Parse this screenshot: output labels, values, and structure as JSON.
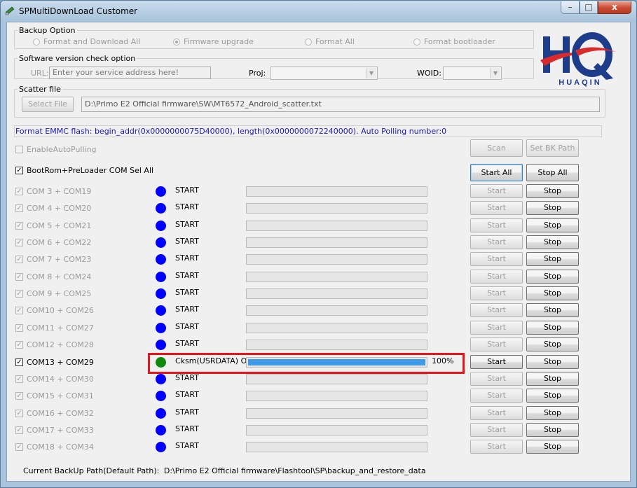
{
  "window": {
    "title": "SPMultiDownLoad Customer",
    "minimize_glyph": "–",
    "maximize_glyph": "□",
    "close_glyph": "x"
  },
  "backup": {
    "legend": "Backup Option",
    "options": [
      {
        "label": "Format and Download All",
        "selected": false
      },
      {
        "label": "Firmware upgrade",
        "selected": true
      },
      {
        "label": "Format All",
        "selected": false
      },
      {
        "label": "Format bootloader",
        "selected": false
      }
    ]
  },
  "version_check": {
    "legend": "Software version check option",
    "url_label": "URL:",
    "url_placeholder": "Enter your service address here!",
    "proj_label": "Proj:",
    "woid_label": "WOID:"
  },
  "scatter": {
    "legend": "Scatter file",
    "select_button": "Select File",
    "path": "D:\\Primo E2 Official firmware\\SW\\MT6572_Android_scatter.txt"
  },
  "info_line": "Format EMMC flash:  begin_addr(0x0000000075D40000), length(0x0000000072240000). Auto Polling number:0",
  "controls": {
    "enable_auto_pulling": "EnableAutoPulling",
    "bootrom_label": "BootRom+PreLoader COM Sel All",
    "scan": "Scan",
    "set_bk_path": "Set BK Path",
    "start_all": "Start All",
    "stop_all": "Stop All"
  },
  "ports": [
    {
      "label": "COM 3 + COM19",
      "status": "START",
      "start": "Start",
      "stop": "Stop",
      "checked": true,
      "enabled": false,
      "progress": 0,
      "percent": "",
      "done": false
    },
    {
      "label": "COM 4 + COM20",
      "status": "START",
      "start": "Start",
      "stop": "Stop",
      "checked": true,
      "enabled": false,
      "progress": 0,
      "percent": "",
      "done": false
    },
    {
      "label": "COM 5 + COM21",
      "status": "START",
      "start": "Start",
      "stop": "Stop",
      "checked": true,
      "enabled": false,
      "progress": 0,
      "percent": "",
      "done": false
    },
    {
      "label": "COM 6 + COM22",
      "status": "START",
      "start": "Start",
      "stop": "Stop",
      "checked": true,
      "enabled": false,
      "progress": 0,
      "percent": "",
      "done": false
    },
    {
      "label": "COM 7 + COM23",
      "status": "START",
      "start": "Start",
      "stop": "Stop",
      "checked": true,
      "enabled": false,
      "progress": 0,
      "percent": "",
      "done": false
    },
    {
      "label": "COM 8 + COM24",
      "status": "START",
      "start": "Start",
      "stop": "Stop",
      "checked": true,
      "enabled": false,
      "progress": 0,
      "percent": "",
      "done": false
    },
    {
      "label": "COM 9 + COM25",
      "status": "START",
      "start": "Start",
      "stop": "Stop",
      "checked": true,
      "enabled": false,
      "progress": 0,
      "percent": "",
      "done": false
    },
    {
      "label": "COM10 + COM26",
      "status": "START",
      "start": "Start",
      "stop": "Stop",
      "checked": true,
      "enabled": false,
      "progress": 0,
      "percent": "",
      "done": false
    },
    {
      "label": "COM11 + COM27",
      "status": "START",
      "start": "Start",
      "stop": "Stop",
      "checked": true,
      "enabled": false,
      "progress": 0,
      "percent": "",
      "done": false
    },
    {
      "label": "COM12 + COM28",
      "status": "START",
      "start": "Start",
      "stop": "Stop",
      "checked": true,
      "enabled": false,
      "progress": 0,
      "percent": "",
      "done": false
    },
    {
      "label": "COM13 + COM29",
      "status": "Cksm(USRDATA) OK",
      "start": "Start",
      "stop": "Stop",
      "checked": true,
      "enabled": true,
      "progress": 1.0,
      "percent": "100%",
      "done": true
    },
    {
      "label": "COM14 + COM30",
      "status": "START",
      "start": "Start",
      "stop": "Stop",
      "checked": true,
      "enabled": false,
      "progress": 0,
      "percent": "",
      "done": false
    },
    {
      "label": "COM15 + COM31",
      "status": "START",
      "start": "Start",
      "stop": "Stop",
      "checked": true,
      "enabled": false,
      "progress": 0,
      "percent": "",
      "done": false
    },
    {
      "label": "COM16 + COM32",
      "status": "START",
      "start": "Start",
      "stop": "Stop",
      "checked": true,
      "enabled": false,
      "progress": 0,
      "percent": "",
      "done": false
    },
    {
      "label": "COM17 + COM33",
      "status": "START",
      "start": "Start",
      "stop": "Stop",
      "checked": true,
      "enabled": false,
      "progress": 0,
      "percent": "",
      "done": false
    },
    {
      "label": "COM18 + COM34",
      "status": "START",
      "start": "Start",
      "stop": "Stop",
      "checked": true,
      "enabled": false,
      "progress": 0,
      "percent": "",
      "done": false
    }
  ],
  "footer": {
    "label": "Current BackUp Path(Default Path):",
    "path": "D:\\Primo E2 Official firmware\\Flashtool\\SP\\backup_and_restore_data"
  },
  "logo": {
    "icon": "huaqin-logo",
    "text": "HUAQIN"
  },
  "colors": {
    "idle_indicator": "#0000ff",
    "done_indicator": "#0f8a0f",
    "progress_fill": "#3d9be9",
    "highlight_box": "#e8161c",
    "info_text": "#1a1ab8"
  }
}
